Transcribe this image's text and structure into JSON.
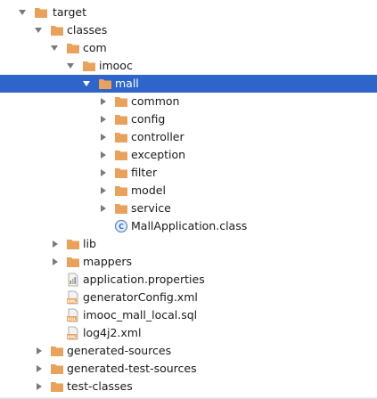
{
  "tree": {
    "target": "target",
    "classes": "classes",
    "com": "com",
    "imooc": "imooc",
    "mall": "mall",
    "common": "common",
    "config": "config",
    "controller": "controller",
    "exception": "exception",
    "filter": "filter",
    "model": "model",
    "service": "service",
    "mall_application": "MallApplication.class",
    "lib": "lib",
    "mappers": "mappers",
    "application_properties": "application.properties",
    "generator_config": "generatorConfig.xml",
    "imooc_mall_local": "imooc_mall_local.sql",
    "log4j2": "log4j2.xml",
    "generated_sources": "generated-sources",
    "generated_test_sources": "generated-test-sources",
    "test_classes": "test-classes"
  },
  "colors": {
    "folder": "#e8a25c",
    "selection": "#2f65ca",
    "arrow": "#7a7a7a"
  },
  "icons": {
    "expanded": "chevron-down-icon",
    "collapsed": "chevron-right-icon",
    "folder": "folder-icon",
    "class_file": "class-file-icon",
    "properties_file": "properties-file-icon",
    "xml_file": "xml-file-icon",
    "sql_file": "sql-file-icon"
  }
}
